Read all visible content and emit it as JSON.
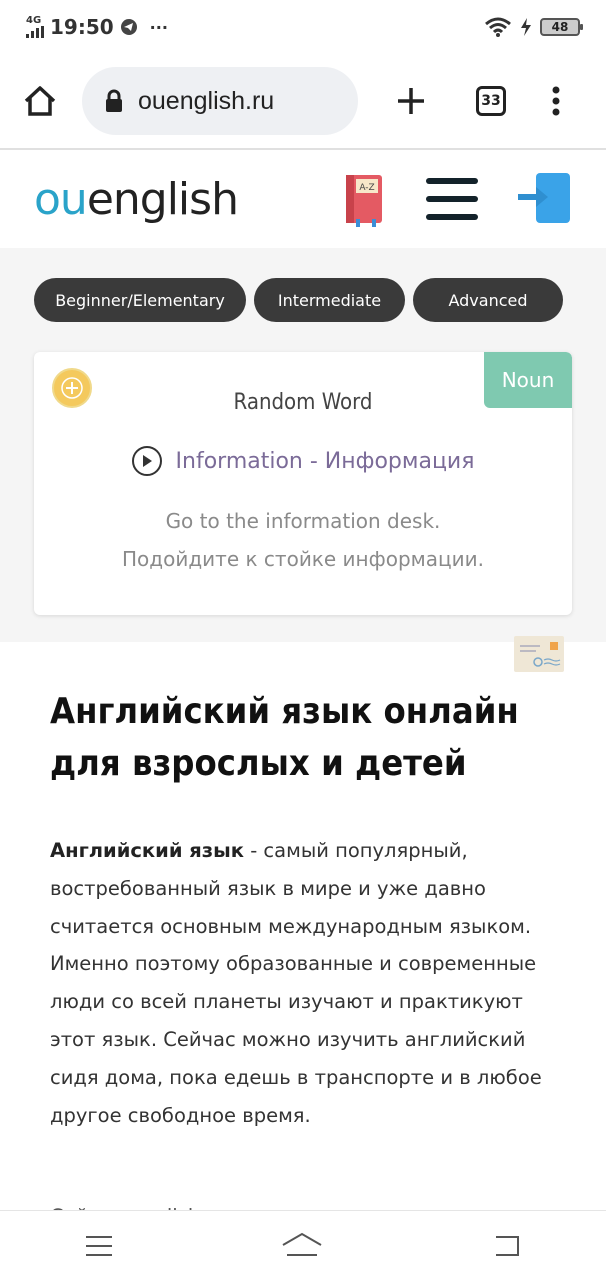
{
  "status_bar": {
    "network": "4G",
    "time": "19:50",
    "more": "···",
    "battery": "48"
  },
  "browser": {
    "url": "ouenglish.ru",
    "tab_count": "33"
  },
  "site": {
    "logo_accent": "ou",
    "logo_rest": "english",
    "accent_color": "#2aa3c9"
  },
  "levels": [
    "Beginner/Elementary",
    "Intermediate",
    "Advanced"
  ],
  "random_word": {
    "tag": "Noun",
    "title": "Random Word",
    "word": "Information - Информация",
    "example_en": "Go to the information desk.",
    "example_ru": "Подойдите к стойке информации."
  },
  "article": {
    "title": "Английский язык онлайн для взрослых и детей",
    "lead_bold": "Английский язык",
    "lead_text": " - самый популярный, востребованный язык в мире и уже давно считается основным международным языком. Именно поэтому образованные и современные люди со всей планеты изучают и практикуют этот язык. Сейчас можно изучить английский сидя дома, пока едешь в транспорте и в любое другое свободное время.",
    "next_line": "Сайт ouenglish..."
  },
  "icons": {
    "home": "home-icon",
    "lock": "lock-icon",
    "plus": "plus-icon",
    "menu_dots": "more-vert-icon",
    "dictionary": "dictionary-icon",
    "hamburger": "hamburger-icon",
    "login": "login-icon",
    "play": "play-icon"
  }
}
